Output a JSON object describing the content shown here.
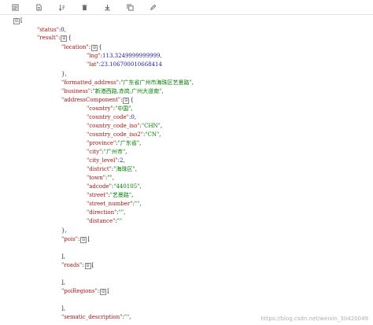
{
  "toolbar": {
    "icons": [
      "format-icon",
      "document-icon",
      "sort-icon",
      "delete-icon",
      "download-icon",
      "copy-icon",
      "edit-icon"
    ]
  },
  "tree": {
    "collapse_glyph": "⊟",
    "root_open": "[",
    "status_key": "\"status\"",
    "status_value": "0",
    "result_key": "\"result\"",
    "location_key": "\"location\"",
    "lng_key": "\"lng\"",
    "lng_value": "113.3249999999999,",
    "lat_key": "\"lat\"",
    "lat_value": "23.106700010668414",
    "formatted_address_key": "\"formatted_address\"",
    "formatted_address_value": "\"广东省广州市海珠区艺景路\"",
    "business_key": "\"business\"",
    "business_value": "\"新港西路,赤岗,广州大道南\"",
    "addressComponent_key": "\"addressComponent\"",
    "country_key": "\"country\"",
    "country_value": "\"中国\"",
    "country_code_key": "\"country_code\"",
    "country_code_value": "0",
    "country_code_iso_key": "\"country_code_iso\"",
    "country_code_iso_value": "\"CHN\"",
    "country_code_iso2_key": "\"country_code_iso2\"",
    "country_code_iso2_value": "\"CN\"",
    "province_key": "\"province\"",
    "province_value": "\"广东省\"",
    "city_key": "\"city\"",
    "city_value": "\"广州市\"",
    "city_level_key": "\"city_level\"",
    "city_level_value": "2",
    "district_key": "\"district\"",
    "district_value": "\"海珠区\"",
    "town_key": "\"town\"",
    "town_value": "\"\"",
    "adcode_key": "\"adcode\"",
    "adcode_value": "\"440105\"",
    "street_key": "\"street\"",
    "street_value": "\"艺景路\"",
    "street_number_key": "\"street_number\"",
    "street_number_value": "\"\"",
    "direction_key": "\"direction\"",
    "direction_value": "\"\"",
    "distance_key": "\"distance\"",
    "distance_value": "\"\"",
    "pois_key": "\"pois\"",
    "roads_key": "\"roads\"",
    "poiRegions_key": "\"poiRegions\"",
    "sematic_description_key": "\"sematic_description\"",
    "sematic_description_value": "\"\""
  },
  "watermark": "https://blog.csdn.net/weixin_30420049"
}
